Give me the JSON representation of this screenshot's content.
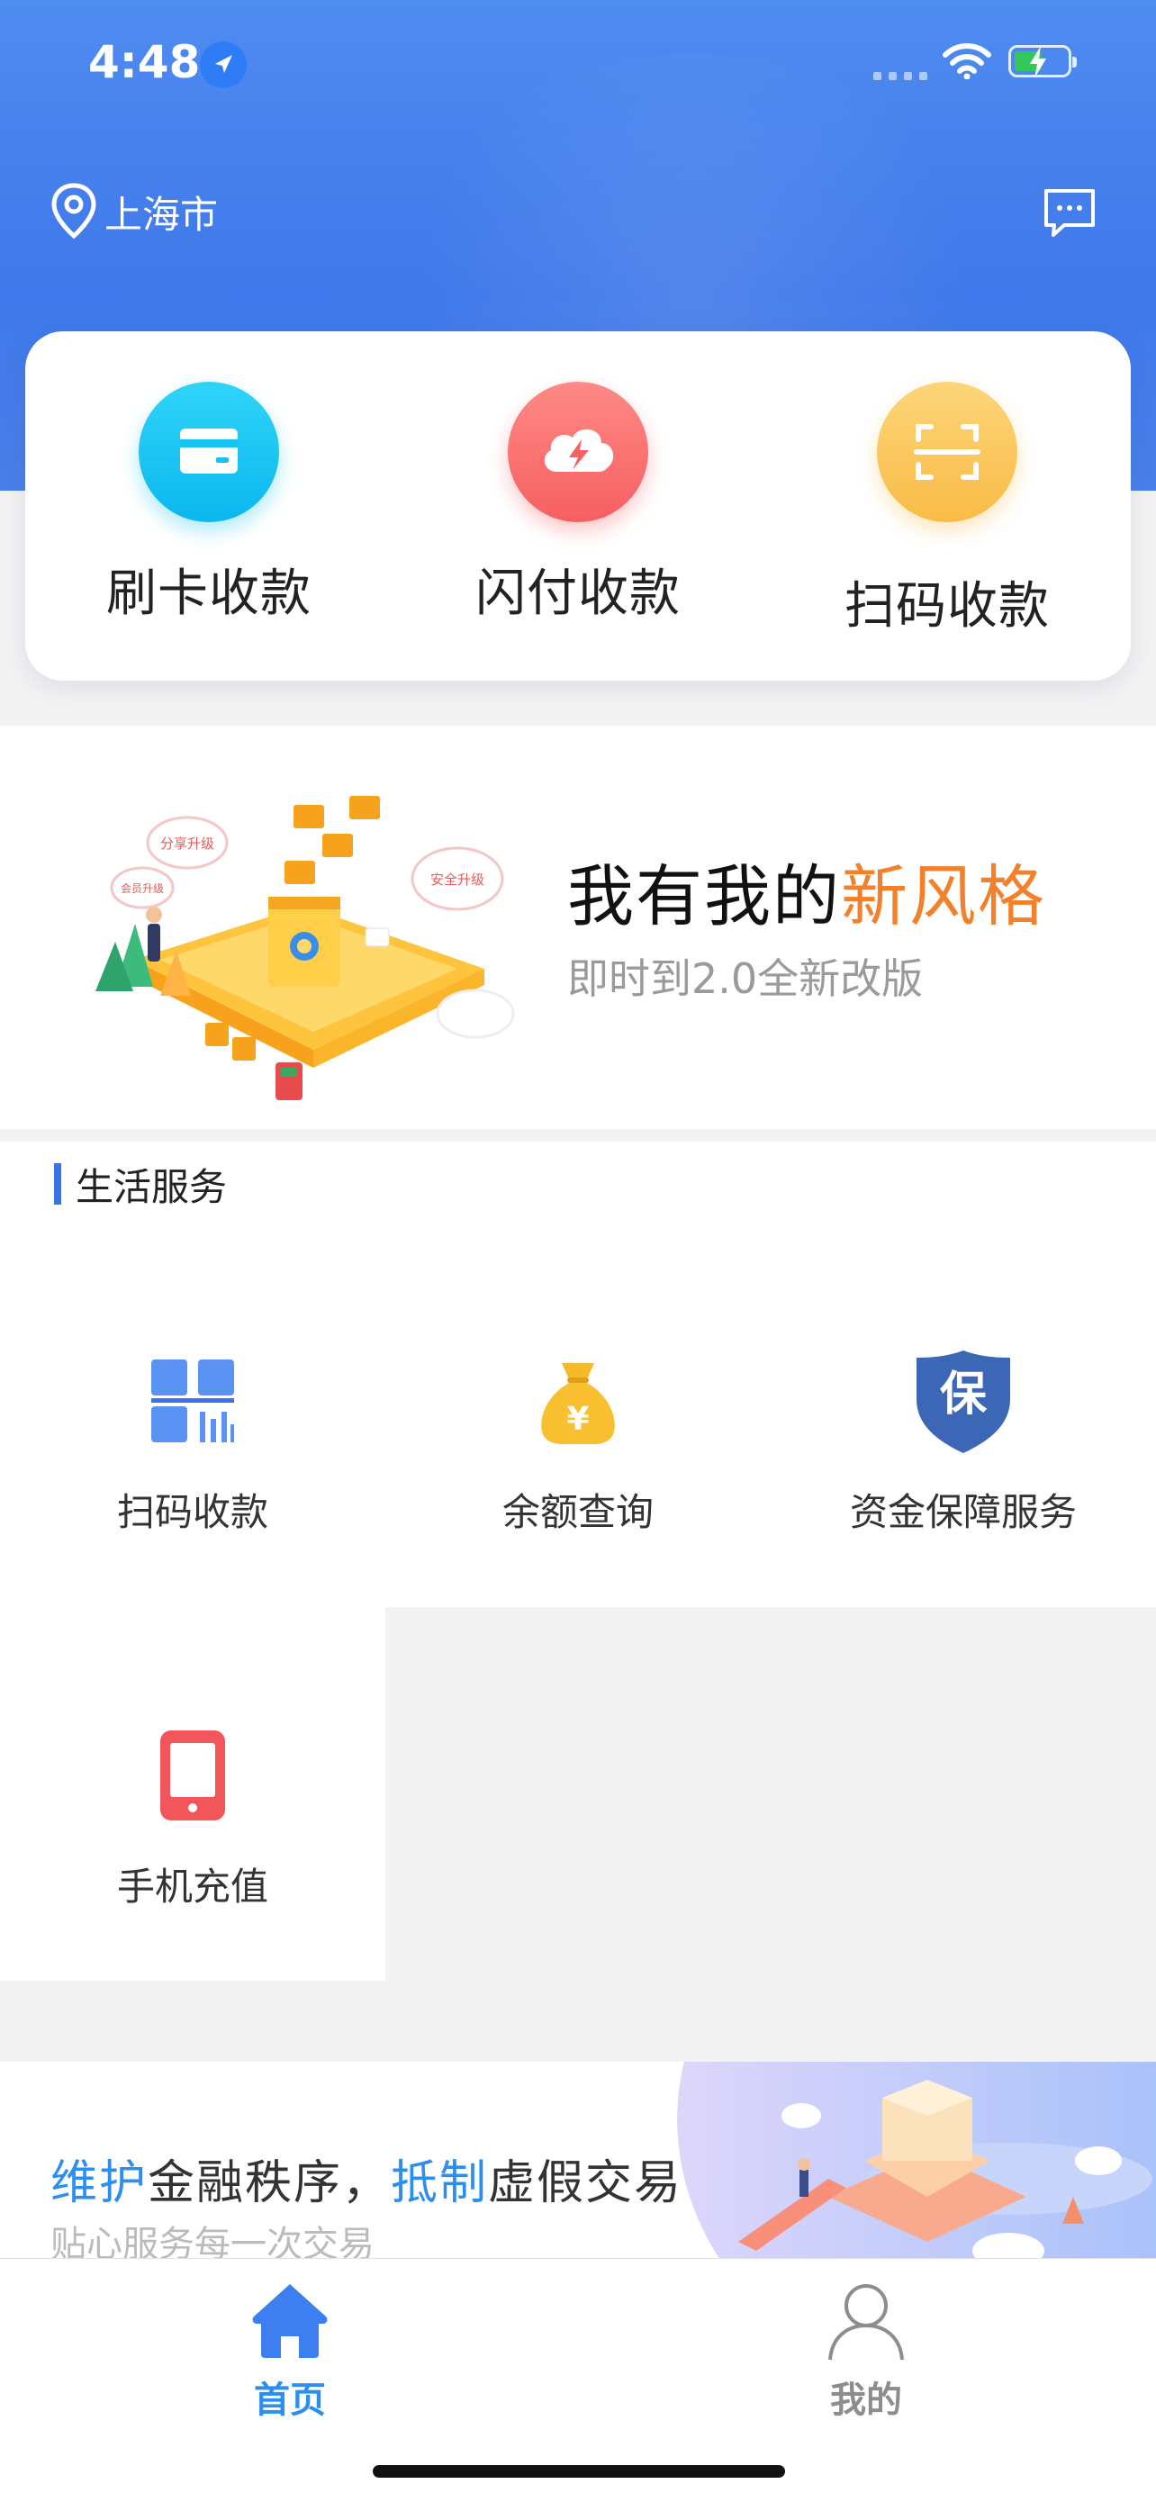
{
  "status_bar": {
    "time": "4:48"
  },
  "header": {
    "city": "上海市"
  },
  "quick_actions": [
    {
      "label": "刷卡收款",
      "icon": "card-icon",
      "color": "#14c3f2"
    },
    {
      "label": "闪付收款",
      "icon": "cloud-flash-icon",
      "color": "#fb6e6e"
    },
    {
      "label": "扫码收款",
      "icon": "scan-frame-icon",
      "color": "#fcc758"
    }
  ],
  "promo_banner": {
    "title_prefix": "我有我的",
    "title_highlight": "新风格",
    "subtitle": "即时到2.0全新改版",
    "art_labels": [
      "分享升级",
      "安全升级",
      "会员升级"
    ],
    "highlight_color": "#f3802a"
  },
  "life_services": {
    "heading": "生活服务",
    "items": [
      {
        "label": "扫码收款",
        "icon": "qr-code-icon"
      },
      {
        "label": "余额查询",
        "icon": "money-bag-icon"
      },
      {
        "label": "资金保障服务",
        "icon": "shield-icon",
        "badge": "保"
      },
      {
        "label": "手机充值",
        "icon": "phone-icon"
      }
    ]
  },
  "bottom_banner": {
    "part1_hl": "维护",
    "part1": "金融秩序，",
    "part2_hl": "抵制",
    "part2": "虚假交易",
    "subtitle": "贴心服务每一次交易"
  },
  "tabbar": {
    "items": [
      {
        "label": "首页",
        "icon": "home-icon",
        "active": true
      },
      {
        "label": "我的",
        "icon": "user-icon",
        "active": false
      }
    ],
    "active_color": "#2c8ff0"
  }
}
